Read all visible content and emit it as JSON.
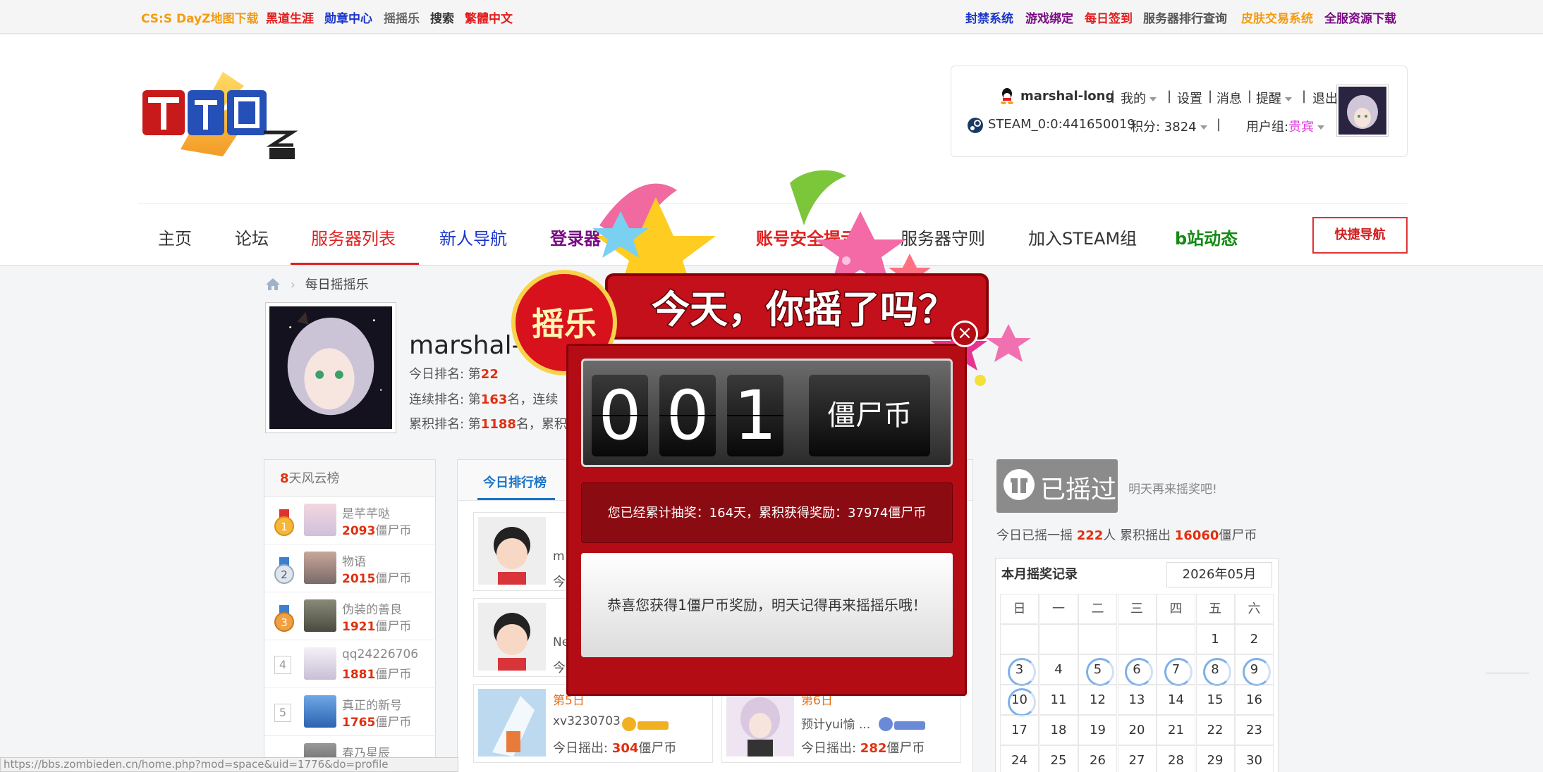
{
  "topbar": {
    "left": [
      {
        "label": "CS:S DayZ地图下载",
        "color": "#f39c12"
      },
      {
        "label": "黑道生涯",
        "color": "#e31b1b"
      },
      {
        "label": "勋章中心",
        "color": "#1a35c9"
      },
      {
        "label": "摇摇乐",
        "color": "#666666"
      },
      {
        "label": "搜索",
        "color": "#333333"
      },
      {
        "label": "繁體中文",
        "color": "#e31b1b"
      }
    ],
    "right": [
      {
        "label": "封禁系统",
        "color": "#1a35c9"
      },
      {
        "label": "游戏绑定",
        "color": "#7a0b85"
      },
      {
        "label": "每日签到",
        "color": "#e31b1b"
      },
      {
        "label": "服务器排行查询",
        "color": "#555555"
      },
      {
        "label": "皮肤交易系统",
        "color": "#f39c12"
      },
      {
        "label": "全服资源下载",
        "color": "#7a0b85"
      }
    ]
  },
  "logo": {
    "alt": "僵尸乐园 Zombie Den"
  },
  "user": {
    "name": "marshal-long",
    "menu": [
      "我的",
      "设置",
      "消息",
      "提醒",
      "退出"
    ],
    "steam": "STEAM_0:0:441650019",
    "points_label": "积分: 3824",
    "group_label": "用户组:",
    "group_value": "贵宾"
  },
  "nav": {
    "items": [
      {
        "label": "主页",
        "color": "#333333"
      },
      {
        "label": "论坛",
        "color": "#333333"
      },
      {
        "label": "服务器列表",
        "color": "#e02020"
      },
      {
        "label": "新人导航",
        "color": "#1a35c9"
      },
      {
        "label": "登录器",
        "color": "#7a0b85"
      },
      {
        "label": "账号安全提示",
        "color": "#e02020"
      },
      {
        "label": "服务器守则",
        "color": "#333333"
      },
      {
        "label": "加入STEAM组",
        "color": "#333333"
      },
      {
        "label": "b站动态",
        "color": "#138a13"
      }
    ],
    "quick": "快捷导航"
  },
  "breadcrumb": {
    "page": "每日摇摇乐"
  },
  "profile": {
    "name": "marshal-",
    "today_rank_prefix": "今日排名: 第",
    "today_rank": "22",
    "streak_rank_prefix": "连续排名: 第",
    "streak_rank": "163",
    "streak_rank_suffix": "名，连续",
    "total_rank_prefix": "累积排名: 第",
    "total_rank": "1188",
    "total_rank_suffix": "名，累积"
  },
  "leaderboard": {
    "title_num": "8",
    "title_text": "天风云榜",
    "rows": [
      {
        "rank": "1",
        "name": "是芊芊哒",
        "score": "2093",
        "unit": "僵尸币"
      },
      {
        "rank": "2",
        "name": "物语",
        "score": "2015",
        "unit": "僵尸币"
      },
      {
        "rank": "3",
        "name": "伪装的善良",
        "score": "1921",
        "unit": "僵尸币"
      },
      {
        "rank": "4",
        "name": "qq24226706",
        "score": "1881",
        "unit": "僵尸币"
      },
      {
        "rank": "5",
        "name": "真正的新号",
        "score": "1765",
        "unit": "僵尸币"
      },
      {
        "rank": "6",
        "name": "春乃星辰",
        "score": "",
        "unit": ""
      }
    ]
  },
  "center": {
    "tab_today": "今日排行榜",
    "cards": [
      {
        "name": "m",
        "rank": "",
        "out_label": "今",
        "out": "",
        "unit": ""
      },
      {
        "name": "Ne",
        "rank": "",
        "out_label": "今",
        "out": "",
        "unit": ""
      },
      {
        "name": "xv3230703",
        "rank": "第5日",
        "out_label": "今日摇出: ",
        "out": "304",
        "unit": "僵尸币"
      },
      {
        "name": "预计yui愉 ...",
        "rank": "第6日",
        "out_label": "今日摇出: ",
        "out": "282",
        "unit": "僵尸币"
      }
    ]
  },
  "right": {
    "shaken": "已摇过",
    "tomorrow": "明天再来摇奖吧!",
    "today_prefix": "今日已摇一摇 ",
    "today_people": "222",
    "today_mid": "人 累积摇出 ",
    "today_total": "16060",
    "today_unit": "僵尸币"
  },
  "calendar": {
    "title": "本月摇奖记录",
    "month": "2026年05月",
    "weekdays": [
      "日",
      "一",
      "二",
      "三",
      "四",
      "五",
      "六"
    ],
    "weeks": [
      [
        "",
        "",
        "",
        "",
        "",
        "1",
        "2"
      ],
      [
        "3",
        "4",
        "5",
        "6",
        "7",
        "8",
        "9"
      ],
      [
        "10",
        "11",
        "12",
        "13",
        "14",
        "15",
        "16"
      ],
      [
        "17",
        "18",
        "19",
        "20",
        "21",
        "22",
        "23"
      ],
      [
        "24",
        "25",
        "26",
        "27",
        "28",
        "29",
        "30"
      ]
    ],
    "signed": [
      "3",
      "5",
      "6",
      "7",
      "8",
      "9",
      "10"
    ]
  },
  "modal": {
    "banner_badge": "摇乐",
    "banner_text": "今天，你摇了吗？",
    "digits": [
      "0",
      "0",
      "1"
    ],
    "coin_label": "僵尸币",
    "cumulative": "您已经累计抽奖：164天，累积获得奖励：37974僵尸币",
    "message": "恭喜您获得1僵尸币奖励，明天记得再来摇摇乐哦！",
    "close": "×"
  },
  "statusbar": {
    "url": "https://bbs.zombieden.cn/home.php?mod=space&uid=1776&do=profile"
  }
}
